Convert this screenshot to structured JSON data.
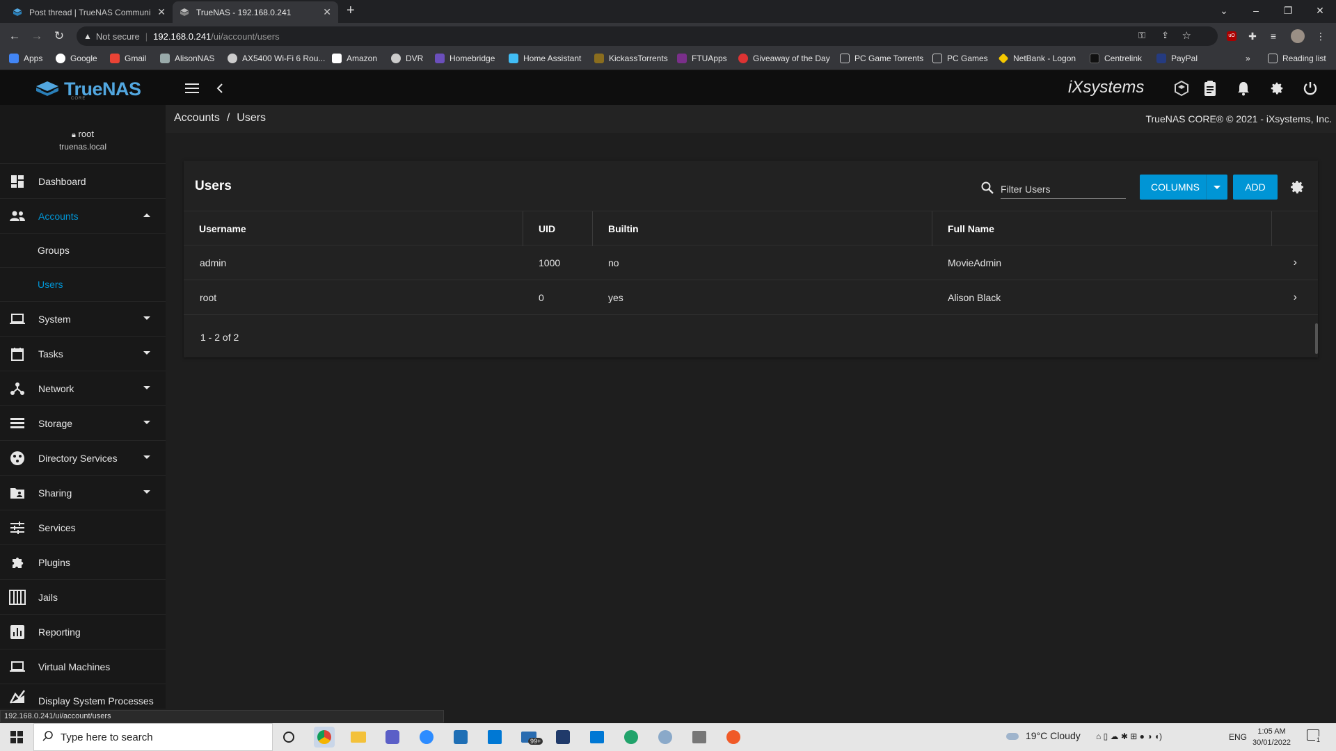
{
  "browser": {
    "tabs": [
      {
        "title": "Post thread | TrueNAS Communi"
      },
      {
        "title": "TrueNAS - 192.168.0.241"
      }
    ],
    "security_label": "Not secure",
    "url_host": "192.168.0.241",
    "url_path": "/ui/account/users",
    "bookmarks": [
      "Apps",
      "Google",
      "Gmail",
      "AlisonNAS",
      "AX5400 Wi-Fi 6 Rou...",
      "Amazon",
      "DVR",
      "Homebridge",
      "Home Assistant",
      "KickassTorrents",
      "FTUApps",
      "Giveaway of the Day",
      "PC Game Torrents",
      "PC Games",
      "NetBank - Logon",
      "Centrelink",
      "PayPal"
    ],
    "bookmarks_overflow": "»",
    "reading_list": "Reading list",
    "status_url": "192.168.0.241/ui/account/users"
  },
  "app": {
    "logo_text": "TrueNAS",
    "logo_sub": "CORE",
    "vendor": "iXsystems",
    "user": {
      "name": "root",
      "host": "truenas.local"
    },
    "breadcrumb": [
      "Accounts",
      "Users"
    ],
    "breadcrumb_sep": "/",
    "copyright": "TrueNAS CORE® © 2021 - iXsystems, Inc."
  },
  "sidebar": {
    "items": [
      {
        "label": "Dashboard"
      },
      {
        "label": "Accounts"
      },
      {
        "label": "Groups"
      },
      {
        "label": "Users"
      },
      {
        "label": "System"
      },
      {
        "label": "Tasks"
      },
      {
        "label": "Network"
      },
      {
        "label": "Storage"
      },
      {
        "label": "Directory Services"
      },
      {
        "label": "Sharing"
      },
      {
        "label": "Services"
      },
      {
        "label": "Plugins"
      },
      {
        "label": "Jails"
      },
      {
        "label": "Reporting"
      },
      {
        "label": "Virtual Machines"
      },
      {
        "label": "Display System Processes"
      }
    ],
    "accent": "#0095d5"
  },
  "users_card": {
    "title": "Users",
    "filter_placeholder": "Filter Users",
    "columns_label": "COLUMNS",
    "add_label": "ADD",
    "headers": [
      "Username",
      "UID",
      "Builtin",
      "Full Name"
    ],
    "rows": [
      {
        "username": "admin",
        "uid": "1000",
        "builtin": "no",
        "full_name": "MovieAdmin"
      },
      {
        "username": "root",
        "uid": "0",
        "builtin": "yes",
        "full_name": "Alison Black"
      }
    ],
    "pager": "1 - 2 of 2"
  },
  "taskbar": {
    "search_placeholder": "Type here to search",
    "weather": "19°C  Cloudy",
    "lang": "ENG",
    "time": "1:05 AM",
    "date": "30/01/2022",
    "mail_badge": "99+",
    "notif_count": "1"
  }
}
